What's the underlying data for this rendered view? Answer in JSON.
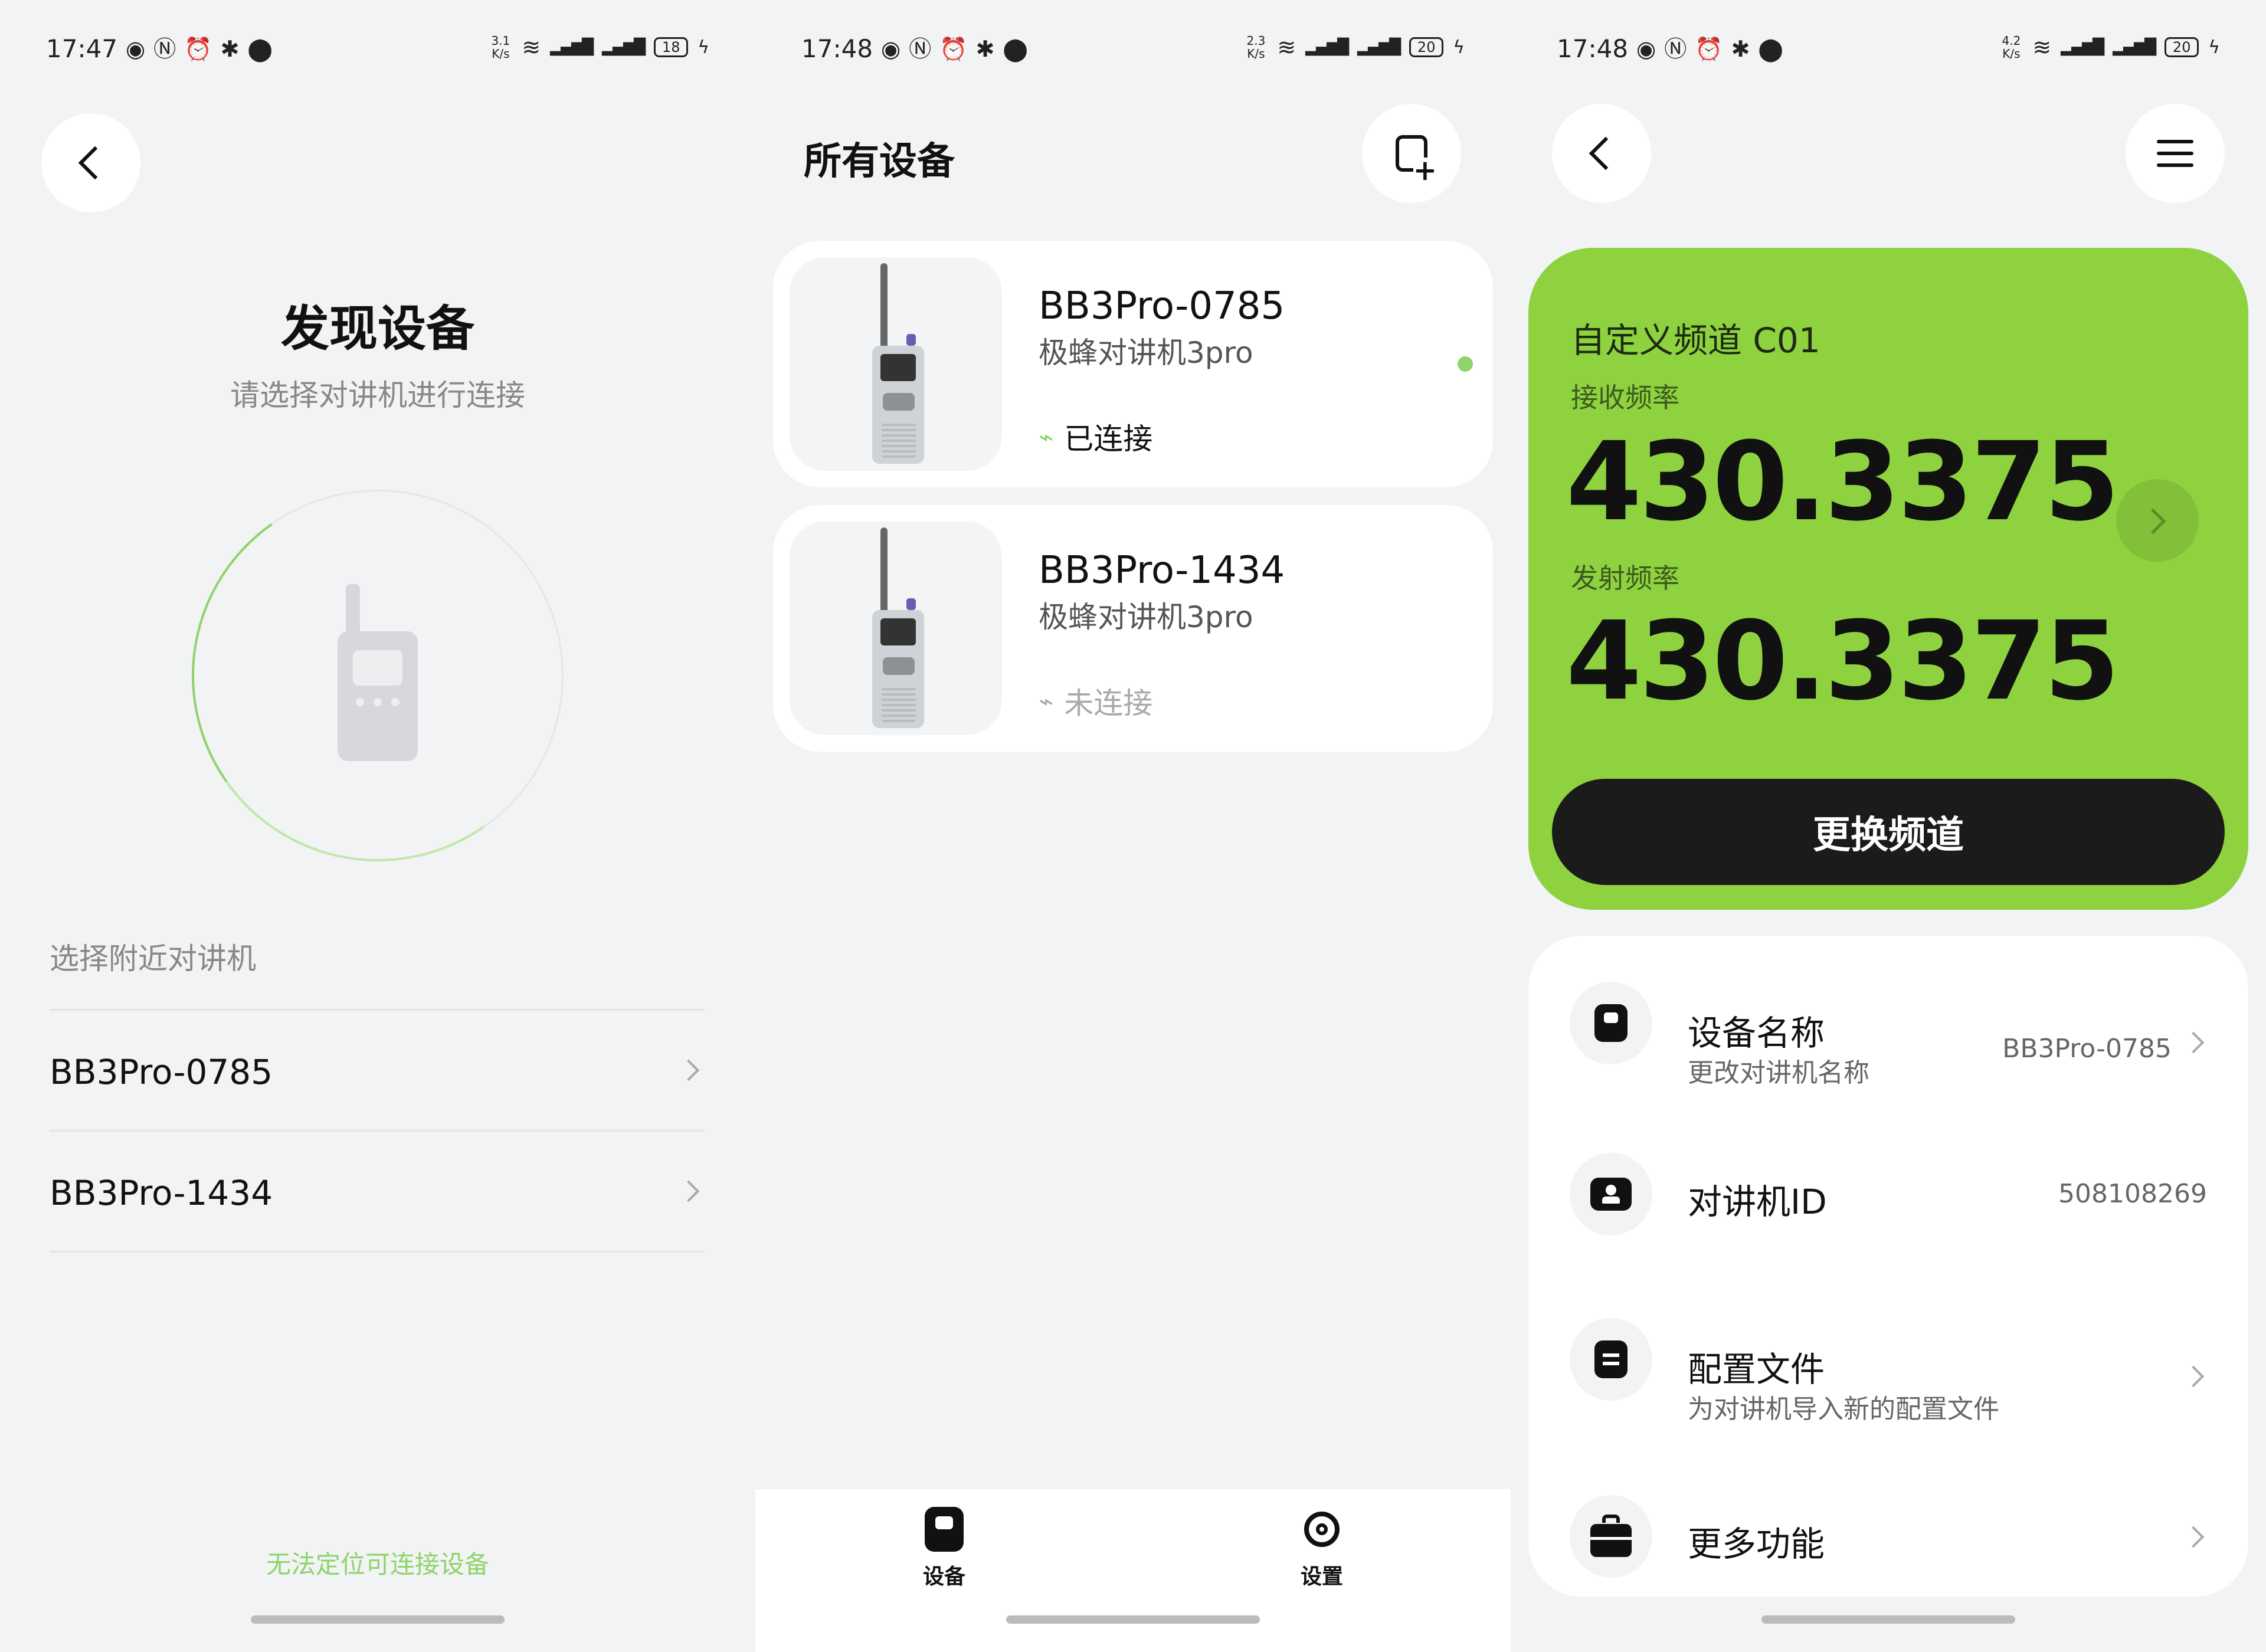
{
  "status_bars": [
    {
      "time": "17:47",
      "speed": "3.1\nK/s",
      "battery": "18"
    },
    {
      "time": "17:48",
      "speed": "2.3\nK/s",
      "battery": "20"
    },
    {
      "time": "17:48",
      "speed": "4.2\nK/s",
      "battery": "20"
    }
  ],
  "discover": {
    "title": "发现设备",
    "subtitle": "请选择对讲机进行连接",
    "section_label": "选择附近对讲机",
    "items": [
      {
        "label": "BB3Pro-0785"
      },
      {
        "label": "BB3Pro-1434"
      }
    ],
    "cannot_find_link": "无法定位可连接设备"
  },
  "devices": {
    "title": "所有设备",
    "cards": [
      {
        "name": "BB3Pro-0785",
        "model": "极蜂对讲机3pro",
        "status": "已连接",
        "status_color": "#8ed46a",
        "online": true
      },
      {
        "name": "BB3Pro-1434",
        "model": "极蜂对讲机3pro",
        "status": "未连接",
        "status_color": "#aaaaaa",
        "online": false
      }
    ],
    "tabs": [
      {
        "label": "设备"
      },
      {
        "label": "设置"
      }
    ]
  },
  "detail": {
    "accent": "#8ed23f",
    "channel": "自定义频道 C01",
    "rx_label": "接收频率",
    "rx_freq": "430.3375",
    "tx_label": "发射频率",
    "tx_freq": "430.3375",
    "change_button": "更换频道",
    "settings": [
      {
        "title": "设备名称",
        "subtitle": "更改对讲机名称",
        "value": "BB3Pro-0785"
      },
      {
        "title": "对讲机ID",
        "subtitle": "",
        "value": "508108269"
      },
      {
        "title": "配置文件",
        "subtitle": "为对讲机导入新的配置文件",
        "value": ""
      },
      {
        "title": "更多功能",
        "subtitle": "",
        "value": ""
      }
    ]
  }
}
